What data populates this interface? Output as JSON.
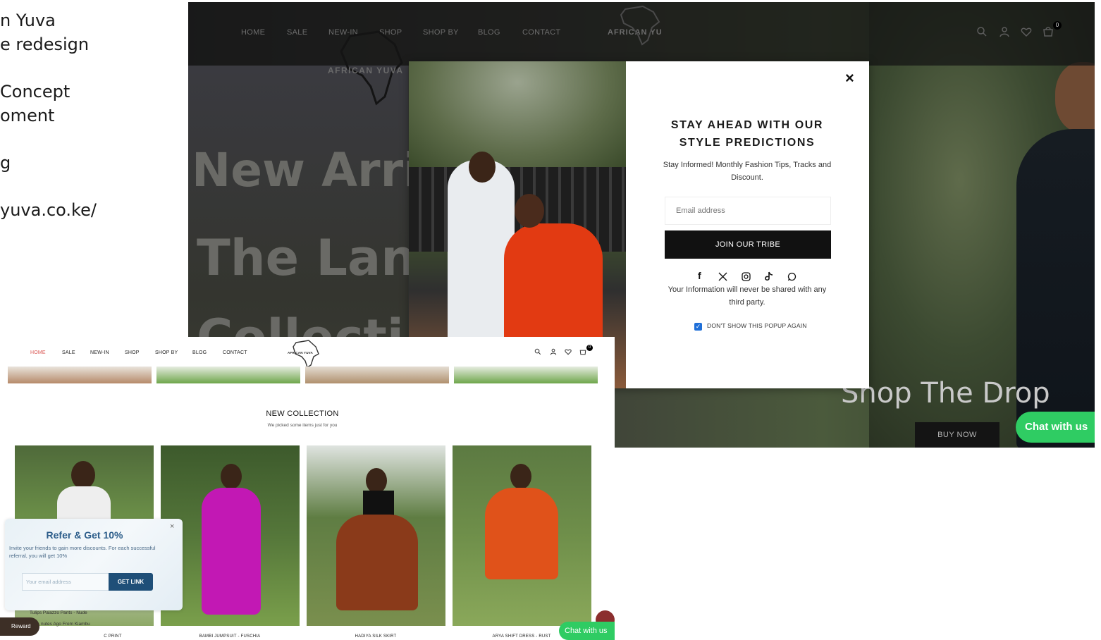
{
  "caption": {
    "lines": [
      "n Yuva",
      "e redesign",
      "Concept",
      "oment",
      "g",
      "yuva.co.ke/"
    ]
  },
  "main_shot": {
    "nav": [
      "HOME",
      "SALE",
      "NEW-IN",
      "SHOP",
      "SHOP BY",
      "BLOG",
      "CONTACT"
    ],
    "logo_text": "AFRICAN YUVA",
    "logo_text_top": "AFRICAN YU",
    "cart_count": "0",
    "hero": {
      "line1": "New Arri",
      "line2": "The Lan",
      "line3": "Collecti"
    },
    "shop_drop": "Shop The Drop",
    "buy_now": "BUY NOW",
    "chat": "Chat with us"
  },
  "popup": {
    "close": "×",
    "title_line1": "STAY AHEAD WITH OUR",
    "title_line2": "STYLE PREDICTIONS",
    "subtitle": "Stay Informed! Monthly Fashion Tips, Tracks and Discount.",
    "email_placeholder": "Email address",
    "button": "JOIN OUR TRIBE",
    "social_icons": [
      "facebook-icon",
      "x-icon",
      "instagram-icon",
      "tiktok-icon",
      "whatsapp-icon"
    ],
    "note": "Your Information will never be shared with any third party.",
    "checkbox_label": "DON'T SHOW THIS POPUP AGAIN",
    "checkbox_checked": true
  },
  "small_shot": {
    "nav": [
      "HOME",
      "SALE",
      "NEW-IN",
      "SHOP",
      "SHOP BY",
      "BLOG",
      "CONTACT"
    ],
    "logo_text": "AFRICAN YUVA",
    "cart_count": "0",
    "section_title": "NEW COLLECTION",
    "section_sub": "We picked some items just for you",
    "products": [
      {
        "label": "C PRINT"
      },
      {
        "label": "BAMBI JUMPSUIT - FUSCHIA"
      },
      {
        "label": "HADIYA SILK SKIRT"
      },
      {
        "label": "ARYA SHIFT DRESS - RUST"
      }
    ],
    "refer": {
      "title": "Refer & Get 10%",
      "close": "×",
      "text": "Invite your friends to gain more discounts. For each successful referral, you will get 10%",
      "placeholder": "Your email address",
      "button": "GET LINK"
    },
    "toast_line1": "Tulips Palazzo Pants - Nude",
    "toast_line2": "nutes Ago From Kiambu",
    "reward": "Reward",
    "chat": "Chat with us"
  }
}
